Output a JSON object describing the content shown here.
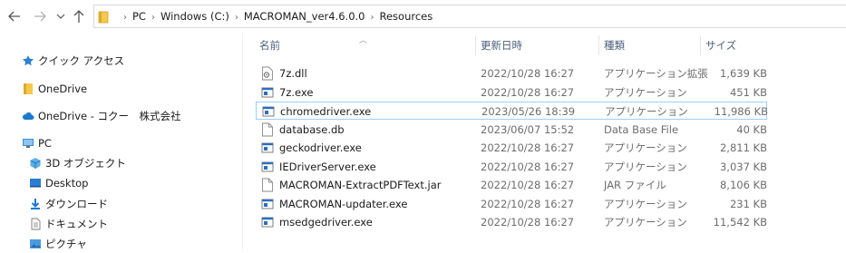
{
  "breadcrumb": [
    "PC",
    "Windows (C:)",
    "MACROMAN_ver4.6.0.0",
    "Resources"
  ],
  "nav_pane": [
    {
      "label": "クイック アクセス",
      "icon": "star-icon"
    },
    {
      "label": "OneDrive",
      "icon": "folder-icon"
    },
    {
      "label": "OneDrive - コクー　株式会社",
      "icon": "cloud-icon"
    },
    {
      "label": "PC",
      "icon": "computer-icon"
    },
    {
      "label": "3D オブジェクト",
      "icon": "cube-icon"
    },
    {
      "label": "Desktop",
      "icon": "desktop-icon"
    },
    {
      "label": "ダウンロード",
      "icon": "download-icon"
    },
    {
      "label": "ドキュメント",
      "icon": "document-icon"
    },
    {
      "label": "ピクチャ",
      "icon": "picture-icon"
    }
  ],
  "columns": {
    "name": "名前",
    "date": "更新日時",
    "type": "種類",
    "size": "サイズ"
  },
  "files": [
    {
      "name": "7z.dll",
      "date": "2022/10/28 16:27",
      "type": "アプリケーション拡張",
      "size": "1,639 KB",
      "icon": "dll"
    },
    {
      "name": "7z.exe",
      "date": "2022/10/28 16:27",
      "type": "アプリケーション",
      "size": "451 KB",
      "icon": "exe"
    },
    {
      "name": "chromedriver.exe",
      "date": "2023/05/26 18:39",
      "type": "アプリケーション",
      "size": "11,986 KB",
      "icon": "exe",
      "selected": true
    },
    {
      "name": "database.db",
      "date": "2023/06/07 15:52",
      "type": "Data Base File",
      "size": "40 KB",
      "icon": "db"
    },
    {
      "name": "geckodriver.exe",
      "date": "2022/10/28 16:27",
      "type": "アプリケーション",
      "size": "2,811 KB",
      "icon": "exe"
    },
    {
      "name": "IEDriverServer.exe",
      "date": "2022/10/28 16:27",
      "type": "アプリケーション",
      "size": "3,037 KB",
      "icon": "exe"
    },
    {
      "name": "MACROMAN-ExtractPDFText.jar",
      "date": "2022/10/28 16:27",
      "type": "JAR ファイル",
      "size": "8,106 KB",
      "icon": "file"
    },
    {
      "name": "MACROMAN-updater.exe",
      "date": "2022/10/28 16:27",
      "type": "アプリケーション",
      "size": "231 KB",
      "icon": "exe"
    },
    {
      "name": "msedgedriver.exe",
      "date": "2022/10/28 16:27",
      "type": "アプリケーション",
      "size": "11,542 KB",
      "icon": "exe"
    }
  ]
}
